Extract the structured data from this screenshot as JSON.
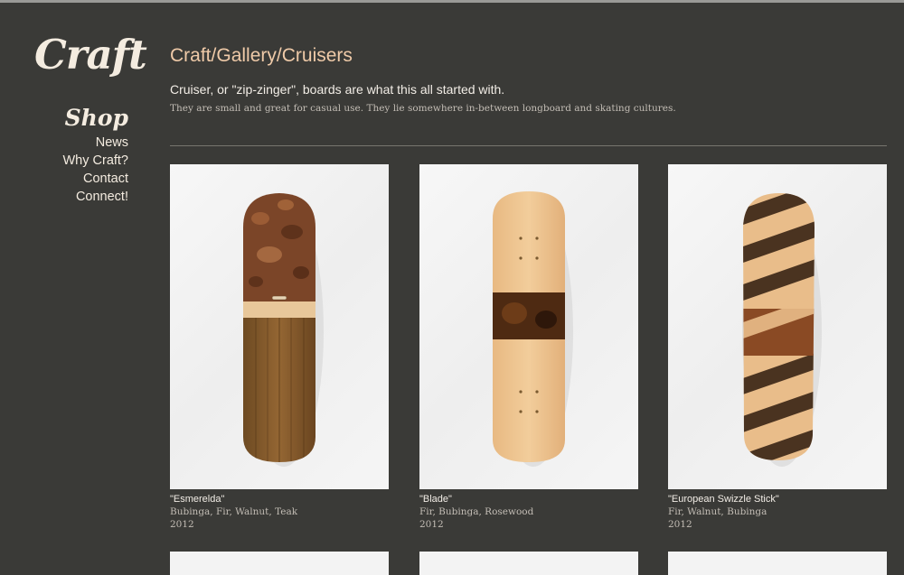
{
  "site": {
    "logo": "Craft"
  },
  "nav": {
    "shop": "Shop",
    "items": [
      "News",
      "Why Craft?",
      "Contact",
      "Connect!"
    ]
  },
  "breadcrumb": {
    "parts": [
      "Craft",
      "Gallery",
      "Cruisers"
    ],
    "separator": "/"
  },
  "intro": "Cruiser, or \"zip-zinger\", boards are what this all started with.",
  "description": "They are small and great for casual use. They lie somewhere in-between longboard and skating cultures.",
  "products": [
    {
      "title": "\"Esmerelda\"",
      "woods": "Bubinga, Fir, Walnut, Teak",
      "year": "2012"
    },
    {
      "title": "\"Blade\"",
      "woods": "Fir, Bubinga, Rosewood",
      "year": "2012"
    },
    {
      "title": "\"European Swizzle Stick\"",
      "woods": "Fir, Walnut, Bubinga",
      "year": "2012"
    }
  ],
  "colors": {
    "background": "#3a3a37",
    "accent": "#efcaa8",
    "text": "#f2ede6"
  }
}
